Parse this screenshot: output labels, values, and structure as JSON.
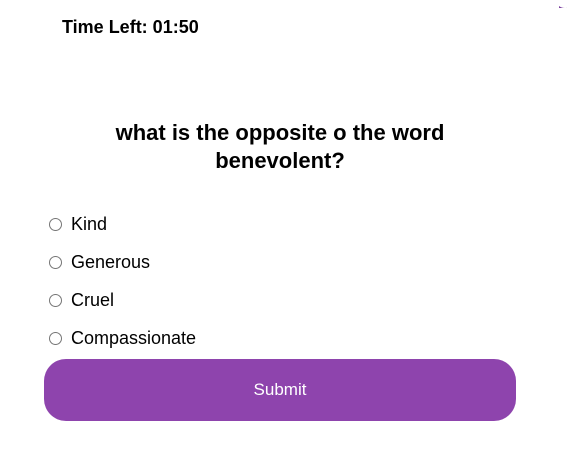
{
  "timer": {
    "label": "Time Left: 01:50"
  },
  "quiz": {
    "question": "what is the opposite o the word benevolent?",
    "options": [
      {
        "label": "Kind"
      },
      {
        "label": "Generous"
      },
      {
        "label": "Cruel"
      },
      {
        "label": "Compassionate"
      }
    ],
    "submit_label": "Submit"
  },
  "colors": {
    "accent": "#8e44ad",
    "button_text": "#ffffff"
  }
}
